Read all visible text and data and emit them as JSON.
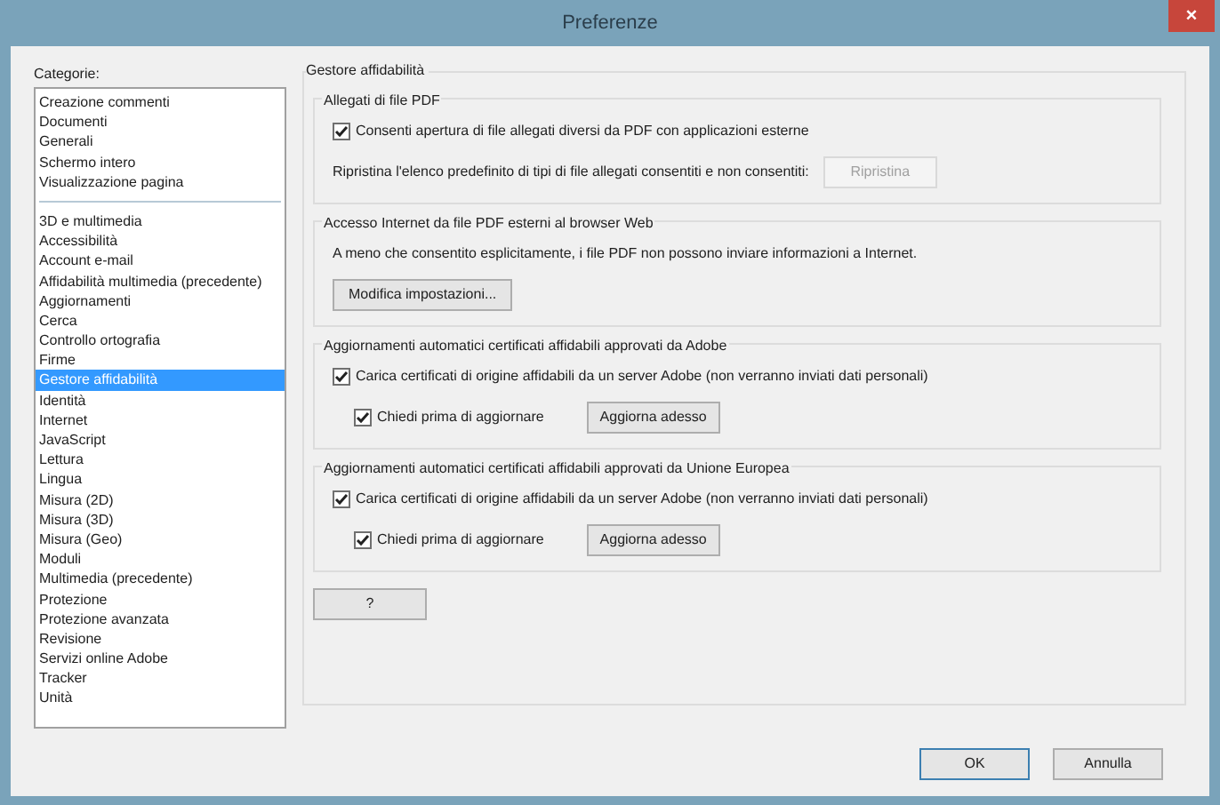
{
  "window": {
    "title": "Preferenze",
    "close": "×"
  },
  "categories": {
    "label": "Categorie:",
    "groups": [
      [
        {
          "label": "Creazione commenti",
          "selected": false
        },
        {
          "label": "Documenti",
          "selected": false
        },
        {
          "label": "Generali",
          "selected": false
        },
        {
          "label": "Schermo intero",
          "selected": false
        },
        {
          "label": "Visualizzazione pagina",
          "selected": false
        }
      ],
      [
        {
          "label": "3D e multimedia",
          "selected": false
        },
        {
          "label": "Accessibilità",
          "selected": false
        },
        {
          "label": "Account e-mail",
          "selected": false
        },
        {
          "label": "Affidabilità multimedia (precedente)",
          "selected": false
        },
        {
          "label": "Aggiornamenti",
          "selected": false
        },
        {
          "label": "Cerca",
          "selected": false
        },
        {
          "label": "Controllo ortografia",
          "selected": false
        },
        {
          "label": "Firme",
          "selected": false
        },
        {
          "label": "Gestore affidabilità",
          "selected": true
        },
        {
          "label": "Identità",
          "selected": false
        },
        {
          "label": "Internet",
          "selected": false
        },
        {
          "label": "JavaScript",
          "selected": false
        },
        {
          "label": "Lettura",
          "selected": false
        },
        {
          "label": "Lingua",
          "selected": false
        },
        {
          "label": "Misura (2D)",
          "selected": false
        },
        {
          "label": "Misura (3D)",
          "selected": false
        },
        {
          "label": "Misura (Geo)",
          "selected": false
        },
        {
          "label": "Moduli",
          "selected": false
        },
        {
          "label": "Multimedia (precedente)",
          "selected": false
        },
        {
          "label": "Protezione",
          "selected": false
        },
        {
          "label": "Protezione avanzata",
          "selected": false
        },
        {
          "label": "Revisione",
          "selected": false
        },
        {
          "label": "Servizi online Adobe",
          "selected": false
        },
        {
          "label": "Tracker",
          "selected": false
        },
        {
          "label": "Unità",
          "selected": false
        }
      ]
    ]
  },
  "panel": {
    "title": "Gestore affidabilità",
    "sections": [
      {
        "title": "Allegati di file PDF",
        "items": [
          {
            "kind": "checkbox",
            "label": "Consenti apertura di file allegati diversi da PDF con applicazioni esterne",
            "checked": true
          },
          {
            "kind": "text_button",
            "text": "Ripristina l'elenco predefinito di tipi di file allegati consentiti e non consentiti:",
            "button": {
              "label": "Ripristina",
              "disabled": true
            }
          }
        ]
      },
      {
        "title": "Accesso Internet da file PDF esterni al browser Web",
        "items": [
          {
            "kind": "text",
            "text": "A meno che consentito esplicitamente, i file PDF non possono inviare informazioni a Internet."
          },
          {
            "kind": "button",
            "label": "Modifica impostazioni..."
          }
        ]
      },
      {
        "title": "Aggiornamenti automatici certificati affidabili approvati da Adobe",
        "items": [
          {
            "kind": "checkbox",
            "label": "Carica certificati di origine affidabili da un server Adobe (non verranno inviati dati personali)",
            "checked": true
          },
          {
            "kind": "checkbox_button",
            "checkbox": {
              "label": "Chiedi prima di aggiornare",
              "checked": true
            },
            "button": {
              "label": "Aggiorna adesso"
            }
          }
        ]
      },
      {
        "title": "Aggiornamenti automatici certificati affidabili approvati da Unione Europea",
        "items": [
          {
            "kind": "checkbox",
            "label": "Carica certificati di origine affidabili da un server Adobe (non verranno inviati dati personali)",
            "checked": true
          },
          {
            "kind": "checkbox_button",
            "checkbox": {
              "label": "Chiedi prima di aggiornare",
              "checked": true
            },
            "button": {
              "label": "Aggiorna adesso"
            }
          }
        ]
      }
    ],
    "help_button": "?"
  },
  "footer": {
    "buttons": [
      {
        "label": "OK",
        "default": true
      },
      {
        "label": "Annulla",
        "default": false
      }
    ]
  }
}
